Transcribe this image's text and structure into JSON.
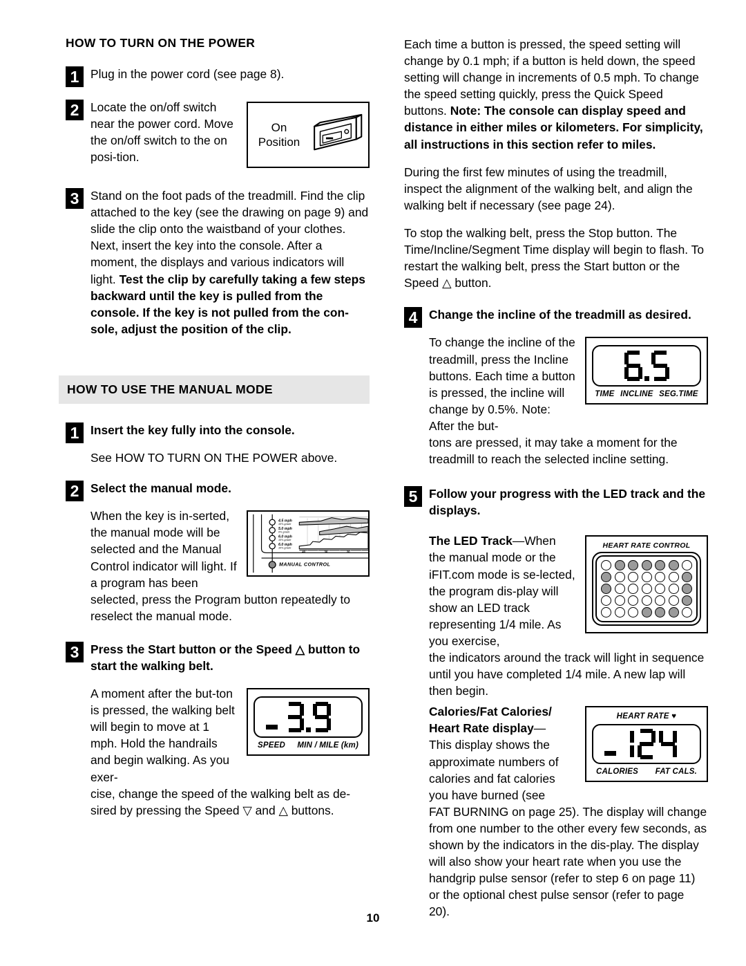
{
  "page": {
    "folio": "10"
  },
  "left_column": {
    "heading_power": "HOW TO TURN ON THE POWER",
    "step1": {
      "num": "1",
      "text": "Plug in the power cord (see page 8)."
    },
    "step2": {
      "num": "2",
      "text": "Locate the on/off switch near the power cord. Move the on/off switch to the on posi-tion.",
      "figure": {
        "label_line1": "On",
        "label_line2": "Position",
        "icon": "rocker-switch-illustration"
      }
    },
    "step3": {
      "num": "3",
      "text_plain": "Stand on the foot pads of the treadmill. Find the clip attached to the key (see the drawing on page 9) and slide the clip onto the waistband of your clothes. Next, insert the key into the console. After a moment, the displays and various indicators will light. ",
      "text_bold": "Test the clip by carefully taking a few steps backward until the key is pulled from the console. If the key is not pulled from the con-sole, adjust the position of the clip."
    },
    "heading_manual": "HOW TO USE THE MANUAL MODE",
    "m_step1": {
      "num": "1",
      "lead": "Insert the key fully into the console.",
      "body": "See HOW TO TURN ON THE POWER above."
    },
    "m_step2": {
      "num": "2",
      "lead": "Select the manual mode.",
      "body_wrap": "When the key is in-serted, the manual mode will be selected and the Manual Control indicator will light. If a program has been",
      "body_rest": "selected, press the Program button repeatedly to reselect the manual mode.",
      "figure": {
        "icon": "manual-control-program-display",
        "indicator_label": "MANUAL CONTROL",
        "speed_labels": [
          {
            "speed": "4.5 mph",
            "grade": "10% grade"
          },
          {
            "speed": "5.0 mph",
            "grade": "0% grade"
          },
          {
            "speed": "6.0 mph",
            "grade": "10% grade"
          },
          {
            "speed": "6.0 mph",
            "grade": "10% grade"
          }
        ],
        "axis_ticks": [
          "40",
          "30",
          "20"
        ]
      }
    },
    "m_step3": {
      "num": "3",
      "lead_part1": "Press the Start button or the Speed ",
      "lead_triangle": "△",
      "lead_part2": " button to start the walking belt.",
      "body_wrap": "A moment after the but-ton is pressed, the walking belt will begin to move at 1 mph. Hold the handrails and begin walking. As you exer-",
      "body_rest_a": "cise, change the speed of the walking belt as de-sired by pressing the Speed ",
      "body_tri_down": "▽",
      "body_rest_b": " and ",
      "body_tri_up": "△",
      "body_rest_c": " buttons.",
      "figure": {
        "icon": "speed-lcd-display",
        "value": "3.9",
        "digits": [
          3,
          9
        ],
        "decimal_point": true,
        "caption_left": "SPEED",
        "caption_right": "MIN / MILE (km)"
      }
    }
  },
  "right_column": {
    "para1_plain": "Each time a button is pressed, the speed setting will change by 0.1 mph; if a button is held down, the speed setting will change in increments of 0.5 mph. To change the speed setting quickly, press the Quick Speed buttons. ",
    "para1_bold": "Note: The console can display speed and distance in either miles or kilometers. For simplicity, all instructions in this section refer to miles.",
    "para2": "During the first few minutes of using the treadmill, inspect the alignment of the walking belt, and align the walking belt if necessary (see page 24).",
    "para3_a": "To stop the walking belt, press the Stop button. The Time/Incline/Segment Time display will begin to flash. To restart the walking belt, press the Start button or the Speed ",
    "para3_tri": "△",
    "para3_b": " button.",
    "step4": {
      "num": "4",
      "lead": "Change the incline of the treadmill as desired.",
      "body_wrap": "To change the incline of the treadmill, press the Incline buttons. Each time a button is pressed, the incline will change by 0.5%. Note: After the but-",
      "body_rest": "tons are pressed, it may take a moment for the treadmill to reach the selected incline setting.",
      "figure": {
        "icon": "incline-lcd-display",
        "value": "6.5",
        "digits": [
          6,
          5
        ],
        "decimal_point": true,
        "captions": [
          "TIME",
          "INCLINE",
          "SEG.TIME"
        ]
      }
    },
    "step5": {
      "num": "5",
      "lead": "Follow your progress with the LED track and the displays.",
      "led_title": "The LED Track",
      "led_dash": "—When",
      "led_body_wrap": "the manual mode or the iFIT.com mode is se-lected, the program dis-play will show an LED track representing 1/4 mile. As you exercise,",
      "led_body_rest": "the indicators around the track will light in sequence until you have completed 1/4 mile. A new lap will then begin.",
      "track_figure": {
        "icon": "led-track-display",
        "caption": "HEART RATE  CONTROL",
        "rows": [
          [
            0,
            1,
            1,
            1,
            1,
            1,
            0
          ],
          [
            1,
            0,
            0,
            0,
            0,
            0,
            1
          ],
          [
            1,
            0,
            0,
            0,
            0,
            0,
            1
          ],
          [
            0,
            0,
            0,
            0,
            0,
            0,
            1
          ],
          [
            0,
            0,
            0,
            1,
            1,
            1,
            0
          ]
        ]
      },
      "cal_title_l1": "Calories/Fat Calories/",
      "cal_title_l2": "Heart Rate display",
      "cal_dash": "—",
      "cal_body_wrap": "This display shows the approximate numbers of calories and fat calories you have burned (see",
      "cal_body_rest": "FAT BURNING on page 25). The display will change from one number to the other every few seconds, as shown by the indicators in the dis-play. The display will also show your heart rate when you use the handgrip pulse sensor (refer to step 6 on page 11) or the optional chest pulse sensor (refer to page 20).",
      "cal_figure": {
        "icon": "calories-lcd-display",
        "top_caption": "HEART RATE",
        "heart_glyph": "♥",
        "value": "124",
        "digits": [
          1,
          2,
          4
        ],
        "caption_left": "CALORIES",
        "caption_right": "FAT CALS."
      }
    }
  },
  "colors": {
    "ink": "#000000",
    "banner_bg": "#e6e6e6",
    "led_on": "#9a9a9a",
    "paper": "#ffffff"
  }
}
